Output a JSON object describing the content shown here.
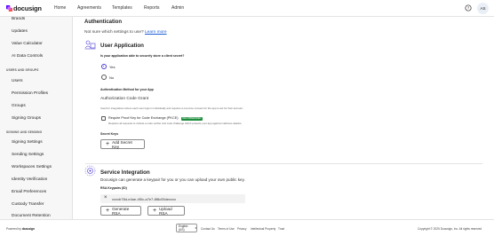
{
  "header": {
    "logo_text": "docusign",
    "nav": [
      "Home",
      "Agreements",
      "Templates",
      "Reports",
      "Admin"
    ],
    "help_icon": "help-circle-icon",
    "avatar_initials": "AS"
  },
  "sidebar": {
    "items_top": [
      "Brands",
      "Updates",
      "Value Calculator",
      "AI Data Controls"
    ],
    "section_users": "USERS AND GROUPS",
    "items_users": [
      "Users",
      "Permission Profiles",
      "Groups",
      "Signing Groups"
    ],
    "section_signing": "SIGNING AND SENDING",
    "items_signing": [
      "Signing Settings",
      "Sending Settings",
      "Workspaces Settings",
      "Identity Verification",
      "Email Preferences",
      "Custody Transfer",
      "Document Retention"
    ]
  },
  "main": {
    "section_title": "Authentication",
    "help_text": "Not sure which settings to use?",
    "learn_more": "Learn more",
    "user_app": {
      "title": "User Application",
      "question": "Is your application able to securely store a client secret?",
      "yes": "Yes",
      "no": "No",
      "auth_method_label": "Authentication Method for your App",
      "auth_code_grant": "Authorization Code Grant",
      "auth_code_desc": "Used for integrations where each user login is individually and requires a one-time consent for the app to act for their account.",
      "pkce_label": "Require Proof Key for Code Exchange (PKCE)",
      "pkce_badge": "RECOMMENDED",
      "pkce_desc": "Requires all requests to include a code verifier and code challenge which protects your app against malicious attacks.",
      "secret_keys_label": "Secret Keys",
      "add_secret_key": "Add Secret Key"
    },
    "service": {
      "title": "Service Integration",
      "desc": "Docusign can generate a keypair for you or you can upload your own public key.",
      "rsa_label": "RSA Keypairs (ID)",
      "rsa_key_id": "xxxxb78d-e4ae-4f0c-a7e7-8f8c05dexxxx",
      "generate_rsa": "Generate RSA",
      "upload_rsa": "Upload RSA"
    }
  },
  "footer": {
    "powered_by": "Powered by",
    "powered_brand": "docusign",
    "language": "English (US)",
    "links": [
      "Contact Us",
      "Terms of Use",
      "Privacy",
      "Intellectual Property",
      "Trust"
    ],
    "copyright": "Copyright © 2025 Docusign, Inc. All rights reserved"
  },
  "colors": {
    "accent": "#4a3bd1",
    "link": "#1a5bd7",
    "badge_green": "#1c8c3a",
    "logo_mark": "#ff3b3b"
  }
}
